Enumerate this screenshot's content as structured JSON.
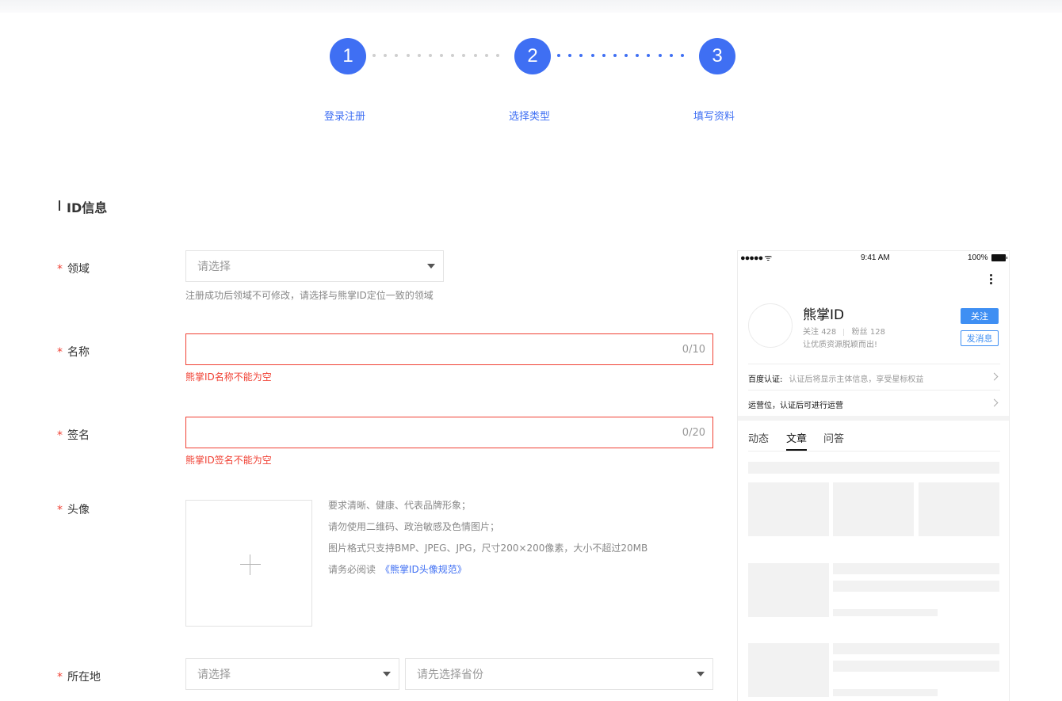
{
  "steps": [
    {
      "number": "1",
      "label": "登录注册"
    },
    {
      "number": "2",
      "label": "选择类型"
    },
    {
      "number": "3",
      "label": "填写资料"
    }
  ],
  "section_title": "ID信息",
  "form": {
    "required_mark": "*",
    "domain": {
      "label": "领域",
      "placeholder": "请选择",
      "hint": "注册成功后领域不可修改，请选择与熊掌ID定位一致的领域"
    },
    "name": {
      "label": "名称",
      "counter": "0/10",
      "error": "熊掌ID名称不能为空"
    },
    "signature": {
      "label": "签名",
      "counter": "0/20",
      "error": "熊掌ID签名不能为空"
    },
    "avatar": {
      "label": "头像",
      "requirements": [
        "要求清晰、健康、代表品牌形象；",
        "请勿使用二维码、政治敏感及色情图片；",
        "图片格式只支持BMP、JPEG、JPG，尺寸200×200像素，大小不超过20MB"
      ],
      "must_read_prefix": "请务必阅读",
      "must_read_link": "《熊掌ID头像规范》"
    },
    "location": {
      "label": "所在地",
      "province_placeholder": "请选择",
      "city_placeholder": "请先选择省份"
    }
  },
  "preview": {
    "status": {
      "time": "9:41 AM",
      "battery": "100%"
    },
    "name": "熊掌ID",
    "follow_label": "关注",
    "follow_count": "428",
    "fans_label": "粉丝",
    "fans_count": "128",
    "bio": "让优质资源脱颖而出!",
    "follow_button": "关注",
    "message_button": "发消息",
    "baidu_cert_label": "百度认证:",
    "baidu_cert_desc": "认证后将显示主体信息，享受星标权益",
    "operation_slot": "运营位，认证后可进行运营",
    "tabs": [
      "动态",
      "文章",
      "问答"
    ],
    "active_tab": "文章"
  },
  "colors": {
    "accent": "#3f6ff3",
    "error": "#f04134",
    "step_dots_done": "#3f6ff3",
    "step_dots_pending": "#cfcfcf"
  }
}
